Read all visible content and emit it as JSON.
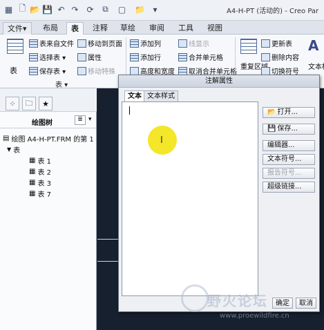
{
  "window": {
    "title": "A4-H-PT (活动的) - Creo Par"
  },
  "tabs": [
    {
      "label": "文件",
      "dropdown": "▾"
    },
    {
      "label": "布局"
    },
    {
      "label": "表"
    },
    {
      "label": "注释"
    },
    {
      "label": "草绘"
    },
    {
      "label": "审阅"
    },
    {
      "label": "工具"
    },
    {
      "label": "视图"
    }
  ],
  "ribbon": {
    "table_label": "表",
    "table_group_label": "表 ▾",
    "from_file": "表来自文件",
    "move_to_page": "移动到页面",
    "add_column": "添加列",
    "line_display": "线显示",
    "update_table": "更新表",
    "select_table": "选择表 ▾",
    "properties": "属性",
    "add_row": "添加行",
    "merge_cells": "合并单元格",
    "delete_content": "删除内容",
    "save_table": "保存表 ▾",
    "move_special": "移动特殊",
    "height_width": "高度和宽度",
    "unmerge_cells": "取消合并单元格",
    "toggle_symbol": "切换符号",
    "repeat_region": "重复区域",
    "text_style": "文本样式"
  },
  "left_panel": {
    "tree_title": "绘图树",
    "drawing_item": "绘图 A4-H-PT.FRM 的第 1",
    "table_root": "表",
    "tables": [
      "表 1",
      "表 2",
      "表 3",
      "表 7"
    ]
  },
  "dialog": {
    "title": "注解属性",
    "tab_text": "文本",
    "tab_text_style": "文本样式",
    "open": "打开...",
    "save": "保存...",
    "editor": "编辑器...",
    "text_symbol": "文本符号...",
    "report_symbol": "报告符号...",
    "hyperlink": "超级链接...",
    "ok": "确定",
    "cancel": "取消"
  },
  "watermark": {
    "text": "野火论坛",
    "url": "www.proewildfire.cn"
  }
}
